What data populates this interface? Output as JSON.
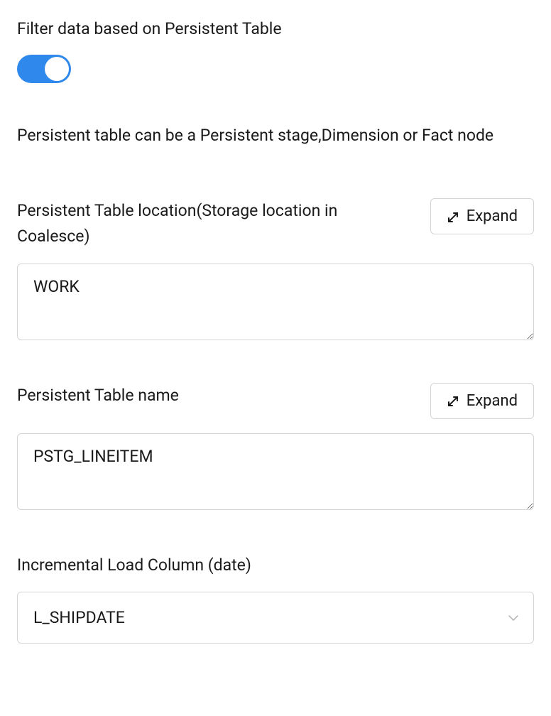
{
  "filter": {
    "label": "Filter data based on Persistent Table",
    "enabled": true
  },
  "description": "Persistent table can be a Persistent stage,Dimension or Fact node",
  "tableLocation": {
    "label": "Persistent Table location(Storage location in Coalesce)",
    "expandLabel": "Expand",
    "value": "WORK"
  },
  "tableName": {
    "label": "Persistent Table name",
    "expandLabel": "Expand",
    "value": "PSTG_LINEITEM"
  },
  "incrementalLoad": {
    "label": "Incremental Load Column (date)",
    "value": "L_SHIPDATE"
  }
}
